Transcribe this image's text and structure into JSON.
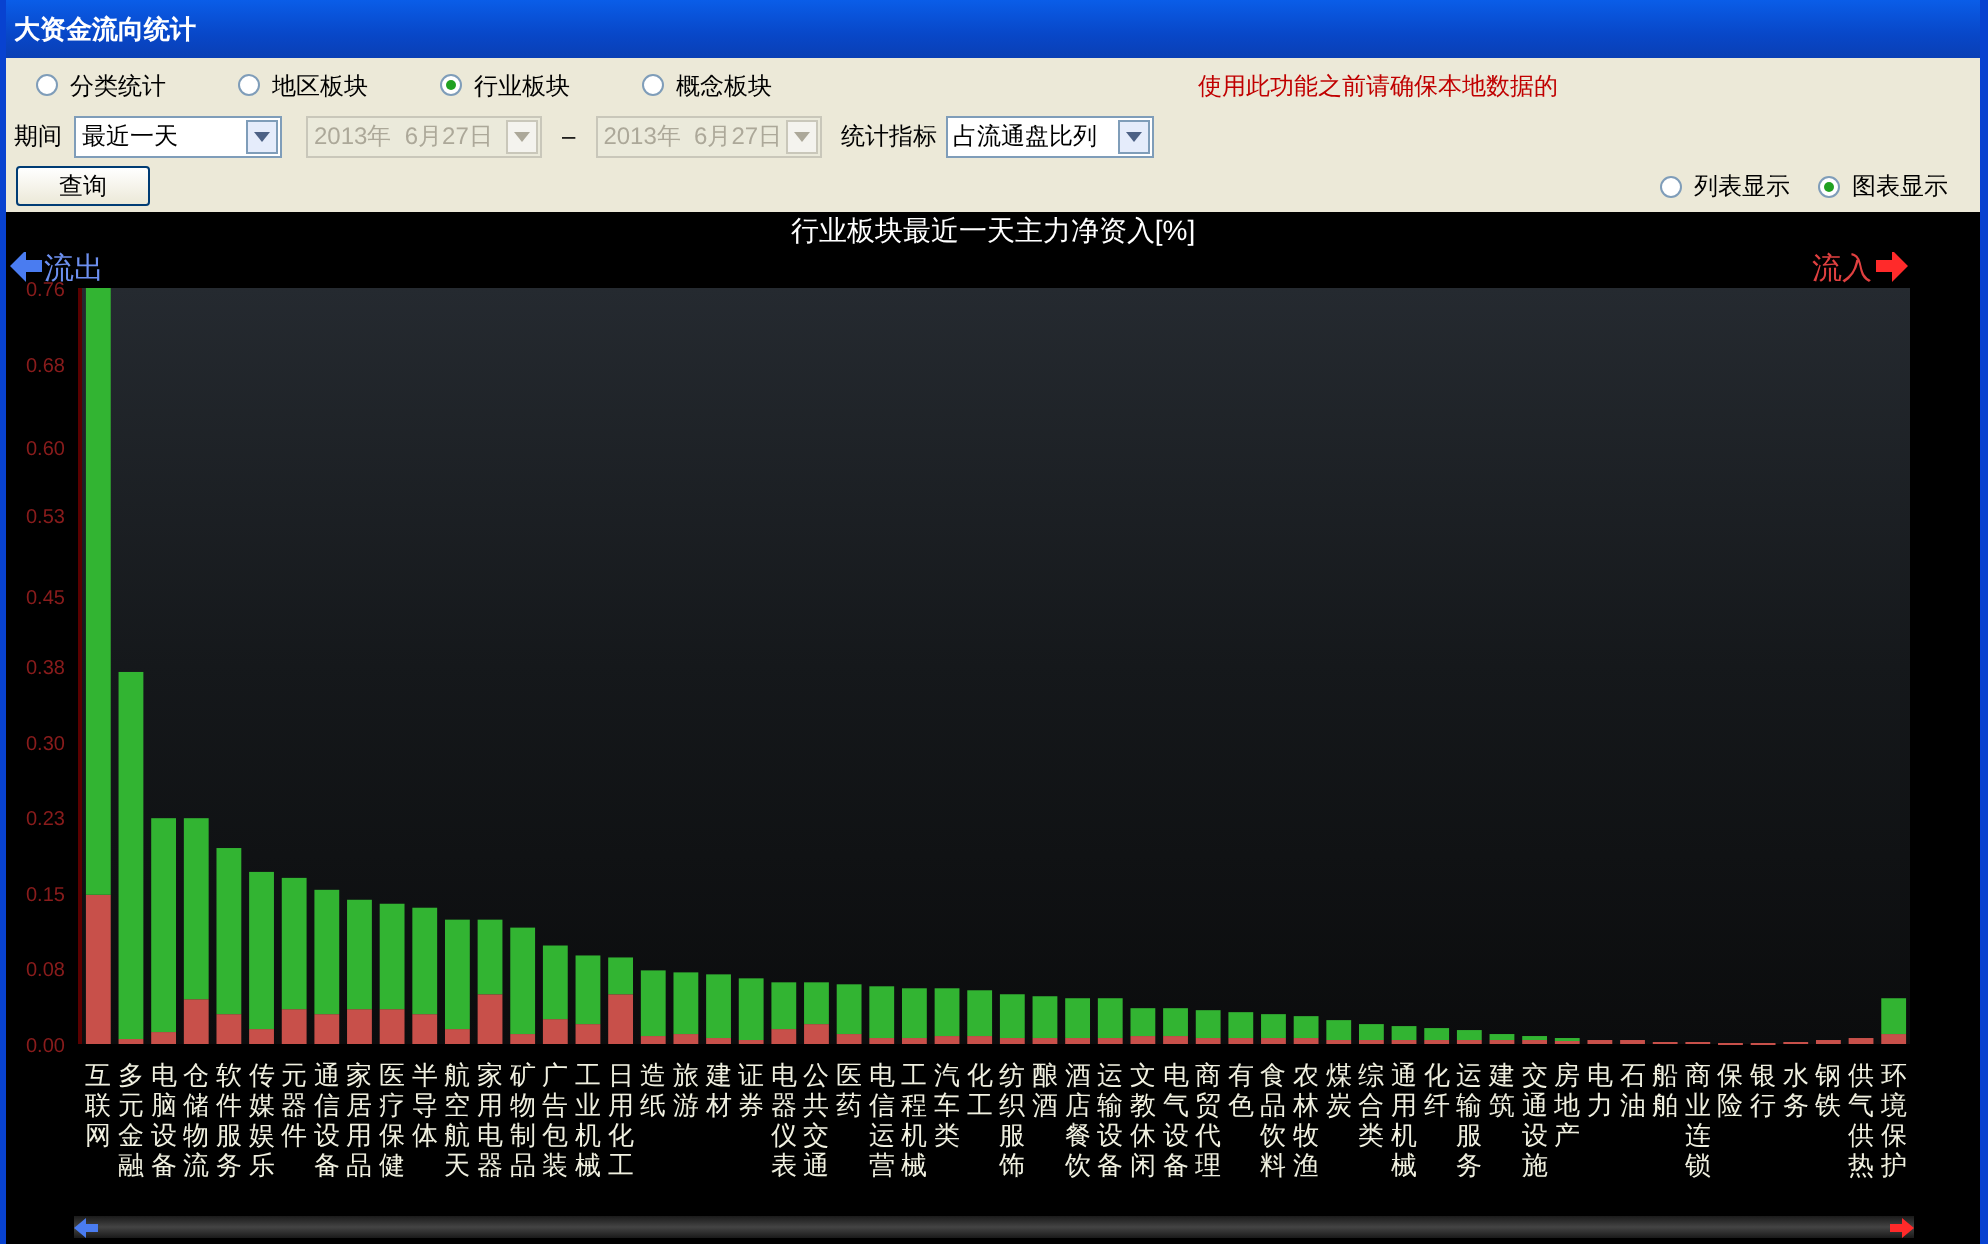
{
  "window": {
    "title": "大资金流向统计"
  },
  "scope_options": [
    {
      "label": "分类统计",
      "selected": false
    },
    {
      "label": "地区板块",
      "selected": false
    },
    {
      "label": "行业板块",
      "selected": true
    },
    {
      "label": "概念板块",
      "selected": false
    }
  ],
  "notice": "使用此功能之前请确保本地数据的",
  "period": {
    "label": "期间",
    "value": "最近一天"
  },
  "date_from": {
    "value": "2013年  6月27日",
    "disabled": true
  },
  "date_separator": "–",
  "date_to": {
    "value": "2013年  6月27日",
    "disabled": true
  },
  "metric": {
    "label": "统计指标",
    "value": "占流通盘比列"
  },
  "query_button": "查询",
  "view_options": [
    {
      "label": "列表显示",
      "selected": false
    },
    {
      "label": "图表显示",
      "selected": true
    }
  ],
  "chart": {
    "outflow_label": "流出",
    "inflow_label": "流入",
    "chart_data": {
      "type": "bar",
      "title": "行业板块最近一天主力净资入[%]",
      "stacked": true,
      "ylim": [
        0,
        0.76
      ],
      "yticks": [
        {
          "value": 0,
          "label": "0.00"
        },
        {
          "value": 0.076,
          "label": "0.08"
        },
        {
          "value": 0.152,
          "label": "0.15"
        },
        {
          "value": 0.228,
          "label": "0.23"
        },
        {
          "value": 0.304,
          "label": "0.30"
        },
        {
          "value": 0.38,
          "label": "0.38"
        },
        {
          "value": 0.45,
          "label": "0.45"
        },
        {
          "value": 0.532,
          "label": "0.53"
        },
        {
          "value": 0.6,
          "label": "0.60"
        },
        {
          "value": 0.684,
          "label": "0.68"
        },
        {
          "value": 0.76,
          "label": "0.76"
        }
      ],
      "categories": [
        "互联网",
        "多元金融",
        "电脑设备",
        "仓储物流",
        "软件服务",
        "传媒娱乐",
        "元器件",
        "通信设备",
        "家居用品",
        "医疗保健",
        "半导体",
        "航空航天",
        "家用电器",
        "矿物制品",
        "广告包装",
        "工业机械",
        "日用化工",
        "造纸",
        "旅游",
        "建材",
        "证券",
        "电器仪表",
        "公共交通",
        "医药",
        "电信运营",
        "工程机械",
        "汽车类",
        "化工",
        "纺织服饰",
        "酿酒",
        "酒店餐饮",
        "运输设备",
        "文教休闲",
        "电气设备",
        "商贸代理",
        "有色",
        "食品饮料",
        "农林牧渔",
        "煤炭",
        "综合类",
        "通用机械",
        "化纤",
        "运输服务",
        "建筑",
        "交通设施",
        "房地产",
        "电力",
        "石油",
        "船舶",
        "商业连锁",
        "保险",
        "银行",
        "水务",
        "钢铁",
        "供气供热",
        "环境保护"
      ],
      "series": [
        {
          "color": "#c8504a",
          "values": [
            0.15,
            0.005,
            0.012,
            0.045,
            0.03,
            0.015,
            0.035,
            0.03,
            0.035,
            0.035,
            0.03,
            0.015,
            0.05,
            0.01,
            0.025,
            0.02,
            0.05,
            0.008,
            0.01,
            0.006,
            0.004,
            0.015,
            0.02,
            0.01,
            0.006,
            0.006,
            0.008,
            0.008,
            0.006,
            0.006,
            0.006,
            0.006,
            0.008,
            0.008,
            0.006,
            0.006,
            0.006,
            0.006,
            0.004,
            0.004,
            0.004,
            0.004,
            0.004,
            0.004,
            0.004,
            0.003,
            0.004,
            0.004,
            0.002,
            0.002,
            0.001,
            0.001,
            0.002,
            0.004,
            0.006,
            0.01
          ]
        },
        {
          "color": "#32b432",
          "values": [
            0.61,
            0.369,
            0.215,
            0.182,
            0.167,
            0.158,
            0.132,
            0.125,
            0.11,
            0.106,
            0.107,
            0.11,
            0.075,
            0.107,
            0.074,
            0.069,
            0.037,
            0.066,
            0.062,
            0.064,
            0.062,
            0.047,
            0.042,
            0.05,
            0.052,
            0.05,
            0.048,
            0.046,
            0.044,
            0.042,
            0.04,
            0.04,
            0.028,
            0.028,
            0.028,
            0.026,
            0.024,
            0.022,
            0.02,
            0.016,
            0.014,
            0.012,
            0.01,
            0.006,
            0.004,
            0.003,
            0,
            0,
            0,
            0,
            0,
            0,
            0,
            0,
            0,
            0.036
          ]
        }
      ]
    }
  }
}
